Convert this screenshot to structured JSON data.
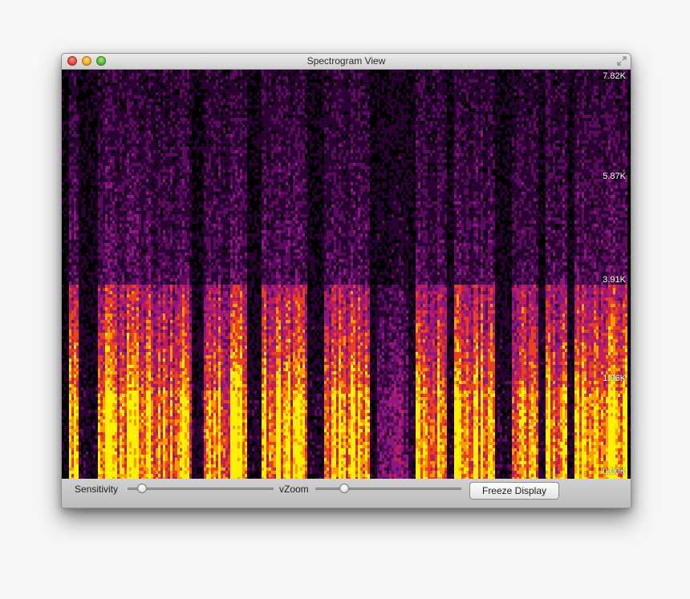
{
  "window": {
    "title": "Spectrogram View"
  },
  "spectrogram": {
    "frequency_labels": [
      "7.82K",
      "5.87K",
      "3.91K",
      "1.96K",
      "0.00K"
    ],
    "colormap": [
      "#000000",
      "#2a0033",
      "#5c0a5e",
      "#8a1880",
      "#c01e5a",
      "#e8421e",
      "#ff9a00",
      "#fff000"
    ]
  },
  "controls": {
    "sensitivity_label": "Sensitivity",
    "sensitivity_value": 0.1,
    "vzoom_label": "vZoom",
    "vzoom_value": 0.2,
    "freeze_label": "Freeze Display"
  },
  "icons": {
    "close": "close-icon",
    "minimize": "minimize-icon",
    "zoom": "zoom-icon",
    "fullscreen": "fullscreen-icon"
  }
}
